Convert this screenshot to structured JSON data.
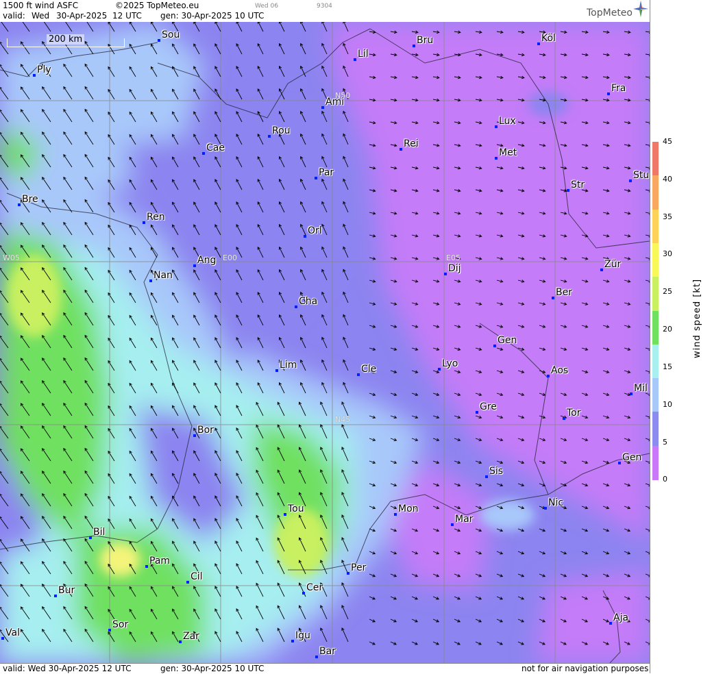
{
  "header": {
    "product": "1500 ft wind ASFC",
    "copyright": "©2025 TopMeteo.eu",
    "valid_label": "valid:",
    "valid_day": "Wed",
    "valid_date": "30-Apr-2025",
    "valid_time": "12 UTC",
    "gen_label": "gen: 30-Apr-2025 10 UTC",
    "small_day": "Wed 06",
    "small_code": "9304",
    "logo": "TopMeteo"
  },
  "scale": {
    "label": "200 km"
  },
  "grid_labels": [
    "N50",
    "N45",
    "W05",
    "E00",
    "E05"
  ],
  "cities": [
    {
      "name": "Sou"
    },
    {
      "name": "Ply"
    },
    {
      "name": "Bru"
    },
    {
      "name": "Köl"
    },
    {
      "name": "Lil"
    },
    {
      "name": "Fra"
    },
    {
      "name": "Ami"
    },
    {
      "name": "Lux"
    },
    {
      "name": "Rou"
    },
    {
      "name": "Cae"
    },
    {
      "name": "Rei"
    },
    {
      "name": "Met"
    },
    {
      "name": "Par"
    },
    {
      "name": "Stu"
    },
    {
      "name": "Str"
    },
    {
      "name": "Bre"
    },
    {
      "name": "Ren"
    },
    {
      "name": "Orl"
    },
    {
      "name": "Ang"
    },
    {
      "name": "Dij"
    },
    {
      "name": "Zür"
    },
    {
      "name": "Nan"
    },
    {
      "name": "Ber"
    },
    {
      "name": "Cha"
    },
    {
      "name": "Gen"
    },
    {
      "name": "Lim"
    },
    {
      "name": "Cle"
    },
    {
      "name": "Lyo"
    },
    {
      "name": "Aos"
    },
    {
      "name": "Mil"
    },
    {
      "name": "Gre"
    },
    {
      "name": "Tor"
    },
    {
      "name": "Bor"
    },
    {
      "name": "Gen"
    },
    {
      "name": "Sis"
    },
    {
      "name": "Tou"
    },
    {
      "name": "Mon"
    },
    {
      "name": "Mar"
    },
    {
      "name": "Nic"
    },
    {
      "name": "Bil"
    },
    {
      "name": "Pam"
    },
    {
      "name": "Cil"
    },
    {
      "name": "Per"
    },
    {
      "name": "Bur"
    },
    {
      "name": "Cer"
    },
    {
      "name": "Val"
    },
    {
      "name": "Sor"
    },
    {
      "name": "Zar"
    },
    {
      "name": "Aja"
    },
    {
      "name": "Igu"
    },
    {
      "name": "Bar"
    }
  ],
  "legend": {
    "title": "wind speed [kt]",
    "ticks": [
      "45",
      "40",
      "35",
      "30",
      "25",
      "20",
      "15",
      "10",
      "5",
      "0"
    ],
    "colors": [
      "#f07868",
      "#f8a860",
      "#fcd258",
      "#f8f858",
      "#c8f060",
      "#70e060",
      "#a8f0f0",
      "#a8c8fa",
      "#8c8cf0",
      "#c878f8"
    ]
  },
  "footer": {
    "valid": "valid: Wed 30-Apr-2025 12 UTC",
    "gen": "gen: 30-Apr-2025 10 UTC",
    "notice": "not for air navigation purposes"
  }
}
